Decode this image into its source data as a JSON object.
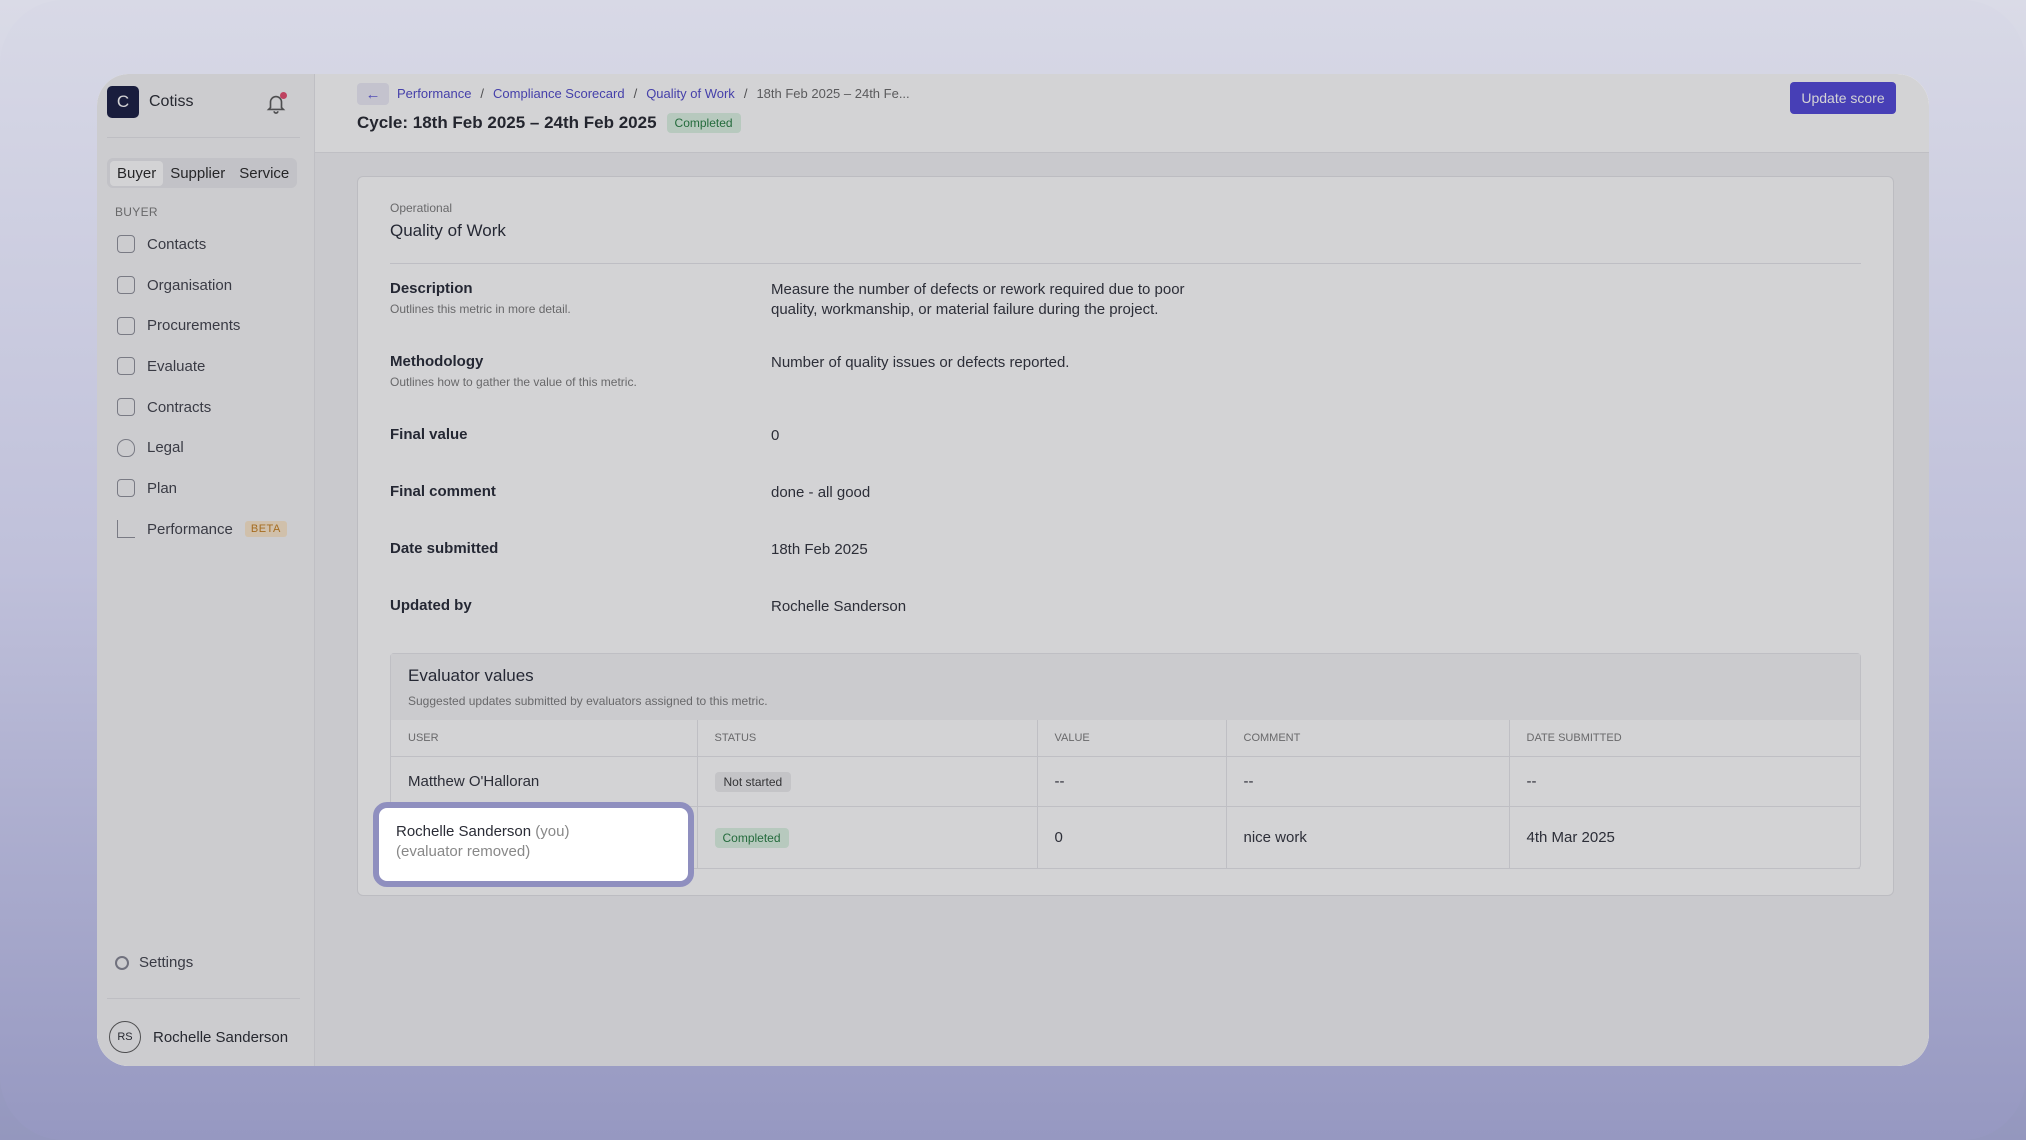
{
  "app": {
    "logo_letter": "C",
    "name": "Cotiss"
  },
  "role_switch": {
    "options": [
      "Buyer",
      "Supplier",
      "Service"
    ],
    "selected": "Buyer"
  },
  "sidebar": {
    "section_label": "BUYER",
    "items": [
      {
        "label": "Contacts",
        "icon": "list-icon"
      },
      {
        "label": "Organisation",
        "icon": "home-icon"
      },
      {
        "label": "Procurements",
        "icon": "document-icon"
      },
      {
        "label": "Evaluate",
        "icon": "evaluate-icon"
      },
      {
        "label": "Contracts",
        "icon": "contract-icon"
      },
      {
        "label": "Legal",
        "icon": "shield-icon"
      },
      {
        "label": "Plan",
        "icon": "plan-icon"
      },
      {
        "label": "Performance",
        "icon": "chart-icon",
        "badge": "BETA"
      }
    ],
    "settings_label": "Settings",
    "user": {
      "initials": "RS",
      "name": "Rochelle Sanderson"
    }
  },
  "header": {
    "breadcrumbs": [
      "Performance",
      "Compliance Scorecard",
      "Quality of Work"
    ],
    "current_crumb": "18th Feb 2025 – 24th Fe...",
    "cycle_title": "Cycle: 18th Feb 2025 – 24th Feb 2025",
    "cycle_status": "Completed",
    "update_button": "Update score"
  },
  "metric": {
    "category": "Operational",
    "title": "Quality of Work",
    "description_label": "Description",
    "description_hint": "Outlines this metric in more detail.",
    "description_value": "Measure the number of defects or rework required due to poor quality, workmanship, or material failure during the project.",
    "methodology_label": "Methodology",
    "methodology_hint": "Outlines how to gather the value of this metric.",
    "methodology_value": "Number of quality issues or defects reported.",
    "final_value_label": "Final value",
    "final_value": "0",
    "final_comment_label": "Final comment",
    "final_comment": "done - all good",
    "date_submitted_label": "Date submitted",
    "date_submitted": "18th Feb 2025",
    "updated_by_label": "Updated by",
    "updated_by": "Rochelle Sanderson"
  },
  "evaluators": {
    "title": "Evaluator values",
    "subtitle": "Suggested updates submitted by evaluators assigned to this metric.",
    "columns": [
      "USER",
      "STATUS",
      "VALUE",
      "COMMENT",
      "DATE SUBMITTED"
    ],
    "rows": [
      {
        "user": "Matthew O'Halloran",
        "status": "Not started",
        "value": "--",
        "comment": "--",
        "date": "--"
      },
      {
        "user": "Rochelle Sanderson",
        "user_suffix": "(you)",
        "user_note": "(evaluator removed)",
        "status": "Completed",
        "value": "0",
        "comment": "nice work",
        "date": "4th Mar 2025"
      }
    ]
  },
  "colors": {
    "accent": "#4c42d8",
    "success_bg": "#dcf3e2",
    "success_text": "#1f7a3c",
    "beta_bg": "#fbe7c9"
  }
}
